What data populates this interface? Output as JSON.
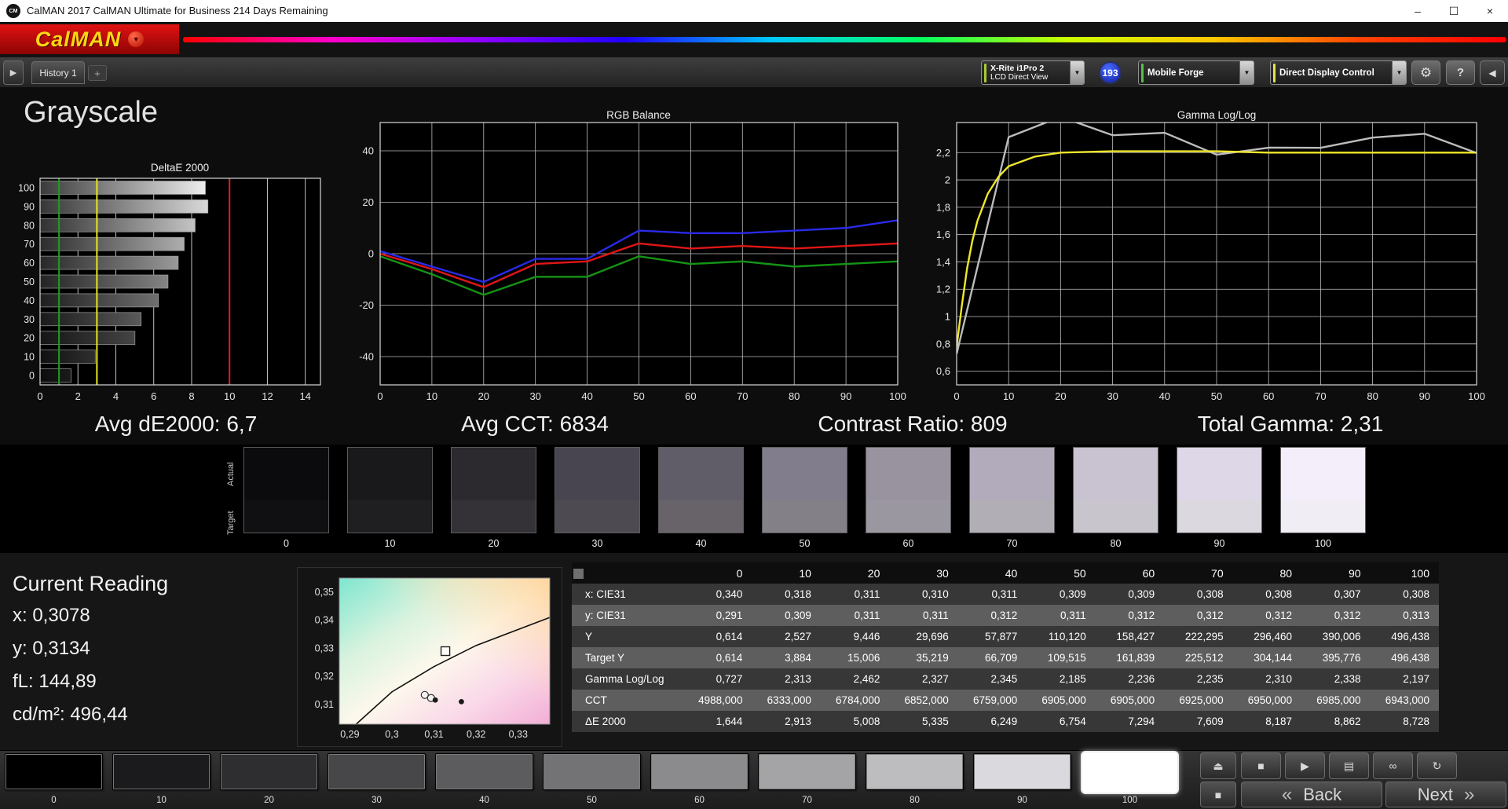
{
  "window": {
    "icon_text": "CM",
    "title": "CalMAN 2017 CalMAN Ultimate for Business 214 Days Remaining",
    "minimize_icon": "–",
    "maximize_icon": "☐",
    "close_icon": "×"
  },
  "brand": {
    "logo_text": "CalMAN",
    "dropdown_icon": "▼"
  },
  "toolbar": {
    "expand_icon": "▶",
    "history_tab": "History 1",
    "add_tab": "+",
    "meter_line1": "X-Rite i1Pro 2",
    "meter_line2": "LCD Direct View",
    "reading_count_badge": "193",
    "source_label": "Mobile Forge",
    "display_control_label": "Direct Display Control",
    "dropdown_icon": "▼",
    "settings_icon": "⚙",
    "help_icon": "?",
    "collapse_icon": "◀",
    "meter_stripe_color": "#aacb36",
    "source_stripe_color": "#54c242",
    "ddc_stripe_color": "#e4e44a"
  },
  "page": {
    "title": "Grayscale"
  },
  "stats": {
    "avg_de2000": "Avg dE2000: 6,7",
    "avg_cct": "Avg CCT: 6834",
    "contrast_ratio": "Contrast Ratio: 809",
    "total_gamma": "Total Gamma: 2,31"
  },
  "chart_data": [
    {
      "id": "deltae",
      "type": "bar",
      "title": "DeltaE 2000",
      "orientation": "horizontal",
      "categories": [
        100,
        90,
        80,
        70,
        60,
        50,
        40,
        30,
        20,
        10,
        0
      ],
      "values": [
        8.728,
        8.862,
        8.187,
        7.609,
        7.294,
        6.754,
        6.249,
        5.335,
        5.008,
        2.913,
        1.644
      ],
      "x_ticks": [
        "0",
        "2",
        "4",
        "6",
        "8",
        "10",
        "12",
        "14"
      ],
      "xlim": [
        0,
        14.8
      ],
      "grid": true,
      "reference_lines": [
        {
          "value": 1,
          "color": "#1ba01b"
        },
        {
          "value": 3,
          "color": "#e6e61e"
        },
        {
          "value": 10,
          "color": "#e02020"
        }
      ]
    },
    {
      "id": "rgb_balance",
      "type": "line",
      "title": "RGB Balance",
      "x": [
        0,
        10,
        20,
        30,
        40,
        50,
        60,
        70,
        80,
        90,
        100
      ],
      "x_ticks": [
        "0",
        "10",
        "20",
        "30",
        "40",
        "50",
        "60",
        "70",
        "80",
        "90",
        "100"
      ],
      "y_ticks": [
        "40",
        "20",
        "0",
        "-20",
        "-40"
      ],
      "y_tick_values": [
        40,
        20,
        0,
        -20,
        -40
      ],
      "ylim": [
        -51,
        51
      ],
      "grid": true,
      "series": [
        {
          "name": "blue",
          "color": "#2a2ae8",
          "values": [
            1,
            -5,
            -11,
            -2,
            -2,
            9,
            8,
            8,
            9,
            10,
            13
          ]
        },
        {
          "name": "red",
          "color": "#e01616",
          "values": [
            0,
            -6,
            -13,
            -4,
            -3,
            4,
            2,
            3,
            2,
            3,
            4
          ]
        },
        {
          "name": "green",
          "color": "#149414",
          "values": [
            -1,
            -8,
            -16,
            -9,
            -9,
            -1,
            -4,
            -3,
            -5,
            -4,
            -3
          ]
        }
      ]
    },
    {
      "id": "gamma",
      "type": "line",
      "title": "Gamma Log/Log",
      "x_ticks": [
        "0",
        "10",
        "20",
        "30",
        "40",
        "50",
        "60",
        "70",
        "80",
        "90",
        "100"
      ],
      "y_ticks": [
        "2,2",
        "2",
        "1,8",
        "1,6",
        "1,4",
        "1,2",
        "1",
        "0,8",
        "0,6"
      ],
      "y_tick_values": [
        2.2,
        2,
        1.8,
        1.6,
        1.4,
        1.2,
        1,
        0.8,
        0.6
      ],
      "ylim": [
        0.5,
        2.42
      ],
      "grid": true,
      "series": [
        {
          "name": "measured",
          "color": "#bcbcbc",
          "x": [
            0,
            10,
            20,
            30,
            40,
            50,
            60,
            70,
            80,
            90,
            100
          ],
          "values": [
            0.727,
            2.313,
            2.462,
            2.327,
            2.345,
            2.185,
            2.236,
            2.235,
            2.31,
            2.338,
            2.197
          ]
        },
        {
          "name": "target",
          "color": "#f0e62a",
          "x": [
            0,
            1,
            2,
            3,
            4,
            6,
            8,
            10,
            15,
            20,
            30,
            40,
            50,
            60,
            70,
            80,
            90,
            100
          ],
          "values": [
            0.78,
            1.08,
            1.35,
            1.55,
            1.7,
            1.9,
            2.02,
            2.1,
            2.17,
            2.2,
            2.21,
            2.21,
            2.21,
            2.2,
            2.2,
            2.2,
            2.2,
            2.2
          ]
        }
      ]
    },
    {
      "id": "cie",
      "type": "scatter",
      "x_ticks": [
        "0,29",
        "0,3",
        "0,31",
        "0,32",
        "0,33"
      ],
      "x_tick_values": [
        0.29,
        0.3,
        0.31,
        0.32,
        0.33
      ],
      "y_ticks": [
        "0,35",
        "0,34",
        "0,33",
        "0,32",
        "0,31"
      ],
      "y_tick_values": [
        0.35,
        0.34,
        0.33,
        0.32,
        0.31
      ],
      "xlim": [
        0.2875,
        0.3375
      ],
      "ylim": [
        0.303,
        0.355
      ],
      "target_square": {
        "x": 0.3127,
        "y": 0.329
      },
      "points": [
        {
          "x": 0.3078,
          "y": 0.3134,
          "style": "open"
        },
        {
          "x": 0.3093,
          "y": 0.3123,
          "style": "open"
        },
        {
          "x": 0.3103,
          "y": 0.3116,
          "style": "filled"
        },
        {
          "x": 0.3165,
          "y": 0.311,
          "style": "filled"
        }
      ],
      "locus": [
        [
          0.2915,
          0.303
        ],
        [
          0.3,
          0.3145
        ],
        [
          0.31,
          0.3235
        ],
        [
          0.32,
          0.331
        ],
        [
          0.3375,
          0.341
        ]
      ]
    }
  ],
  "grayscale_ramp": {
    "actual_label": "Actual",
    "target_label": "Target",
    "swatches": [
      {
        "label": "0",
        "actual": "#0b0b0d",
        "target": "#101012"
      },
      {
        "label": "10",
        "actual": "#19181b",
        "target": "#1f1e21"
      },
      {
        "label": "20",
        "actual": "#2c2a2f",
        "target": "#343237"
      },
      {
        "label": "30",
        "actual": "#484550",
        "target": "#4d4a52"
      },
      {
        "label": "40",
        "actual": "#615d68",
        "target": "#676369"
      },
      {
        "label": "50",
        "actual": "#827d8c",
        "target": "#838088"
      },
      {
        "label": "60",
        "actual": "#99939f",
        "target": "#9b97a0"
      },
      {
        "label": "70",
        "actual": "#b1abbb",
        "target": "#b2aeb6"
      },
      {
        "label": "80",
        "actual": "#c8c2d1",
        "target": "#c9c5cd"
      },
      {
        "label": "90",
        "actual": "#ded7e7",
        "target": "#dcd8e0"
      },
      {
        "label": "100",
        "actual": "#f4eefb",
        "target": "#f1edf5"
      }
    ]
  },
  "current_reading": {
    "heading": "Current Reading",
    "x": "x: 0,3078",
    "y": "y: 0,3134",
    "fl": "fL: 144,89",
    "cdm2": "cd/m²: 496,44"
  },
  "table": {
    "columns": [
      "0",
      "10",
      "20",
      "30",
      "40",
      "50",
      "60",
      "70",
      "80",
      "90",
      "100"
    ],
    "rows": [
      {
        "label": "x: CIE31",
        "values": [
          "0,340",
          "0,318",
          "0,311",
          "0,310",
          "0,311",
          "0,309",
          "0,309",
          "0,308",
          "0,308",
          "0,307",
          "0,308"
        ]
      },
      {
        "label": "y: CIE31",
        "values": [
          "0,291",
          "0,309",
          "0,311",
          "0,311",
          "0,312",
          "0,311",
          "0,312",
          "0,312",
          "0,312",
          "0,312",
          "0,313"
        ]
      },
      {
        "label": "Y",
        "values": [
          "0,614",
          "2,527",
          "9,446",
          "29,696",
          "57,877",
          "110,120",
          "158,427",
          "222,295",
          "296,460",
          "390,006",
          "496,438"
        ]
      },
      {
        "label": "Target Y",
        "values": [
          "0,614",
          "3,884",
          "15,006",
          "35,219",
          "66,709",
          "109,515",
          "161,839",
          "225,512",
          "304,144",
          "395,776",
          "496,438"
        ]
      },
      {
        "label": "Gamma Log/Log",
        "values": [
          "0,727",
          "2,313",
          "2,462",
          "2,327",
          "2,345",
          "2,185",
          "2,236",
          "2,235",
          "2,310",
          "2,338",
          "2,197"
        ]
      },
      {
        "label": "CCT",
        "values": [
          "4988,000",
          "6333,000",
          "6784,000",
          "6852,000",
          "6759,000",
          "6905,000",
          "6905,000",
          "6925,000",
          "6950,000",
          "6985,000",
          "6943,000"
        ]
      },
      {
        "label": "ΔE 2000",
        "values": [
          "1,644",
          "2,913",
          "5,008",
          "5,335",
          "6,249",
          "6,754",
          "7,294",
          "7,609",
          "8,187",
          "8,862",
          "8,728"
        ]
      }
    ]
  },
  "bottom": {
    "patches": [
      {
        "label": "0",
        "color": "#000000"
      },
      {
        "label": "10",
        "color": "#1b1b1d"
      },
      {
        "label": "20",
        "color": "#2e2e31"
      },
      {
        "label": "30",
        "color": "#474749"
      },
      {
        "label": "40",
        "color": "#5c5c5f"
      },
      {
        "label": "50",
        "color": "#737376"
      },
      {
        "label": "60",
        "color": "#8b8b8e"
      },
      {
        "label": "70",
        "color": "#a4a4a7"
      },
      {
        "label": "80",
        "color": "#bdbdc0"
      },
      {
        "label": "90",
        "color": "#dadade"
      },
      {
        "label": "100",
        "color": "#ffffff",
        "selected": true
      }
    ],
    "eject_icon": "⏏",
    "pattern_icon": "■",
    "transport": [
      {
        "name": "stop-icon",
        "glyph": "■"
      },
      {
        "name": "play-icon",
        "glyph": "▶"
      },
      {
        "name": "save-icon",
        "glyph": "▤"
      },
      {
        "name": "continuous-icon",
        "glyph": "∞"
      },
      {
        "name": "loop-icon",
        "glyph": "↻"
      }
    ],
    "back_chevron": "«",
    "back_label": "Back",
    "next_label": "Next",
    "next_chevron": "»"
  }
}
